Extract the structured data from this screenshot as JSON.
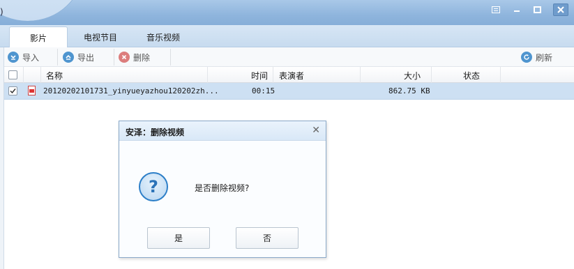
{
  "window": {
    "title": ")"
  },
  "tabs": [
    {
      "label": "影片"
    },
    {
      "label": "电视节目"
    },
    {
      "label": "音乐视频"
    }
  ],
  "toolbar": {
    "import_label": "导入",
    "export_label": "导出",
    "delete_label": "删除",
    "refresh_label": "刷新"
  },
  "table": {
    "columns": [
      "名称",
      "时间",
      "表演者",
      "大小",
      "状态"
    ],
    "rows": [
      {
        "name": "20120202101731_yinyueyazhou120202zh...",
        "time": "00:15",
        "performer": "",
        "size": "862.75 KB",
        "status": ""
      }
    ]
  },
  "dialog": {
    "title": "安泽：删除视频",
    "message": "是否删除视频?",
    "yes_label": "是",
    "no_label": "否"
  },
  "colors": {
    "titlebar": "#8fb5dd",
    "selected_row": "#cde0f3",
    "question_icon": "#2d7fc8"
  }
}
